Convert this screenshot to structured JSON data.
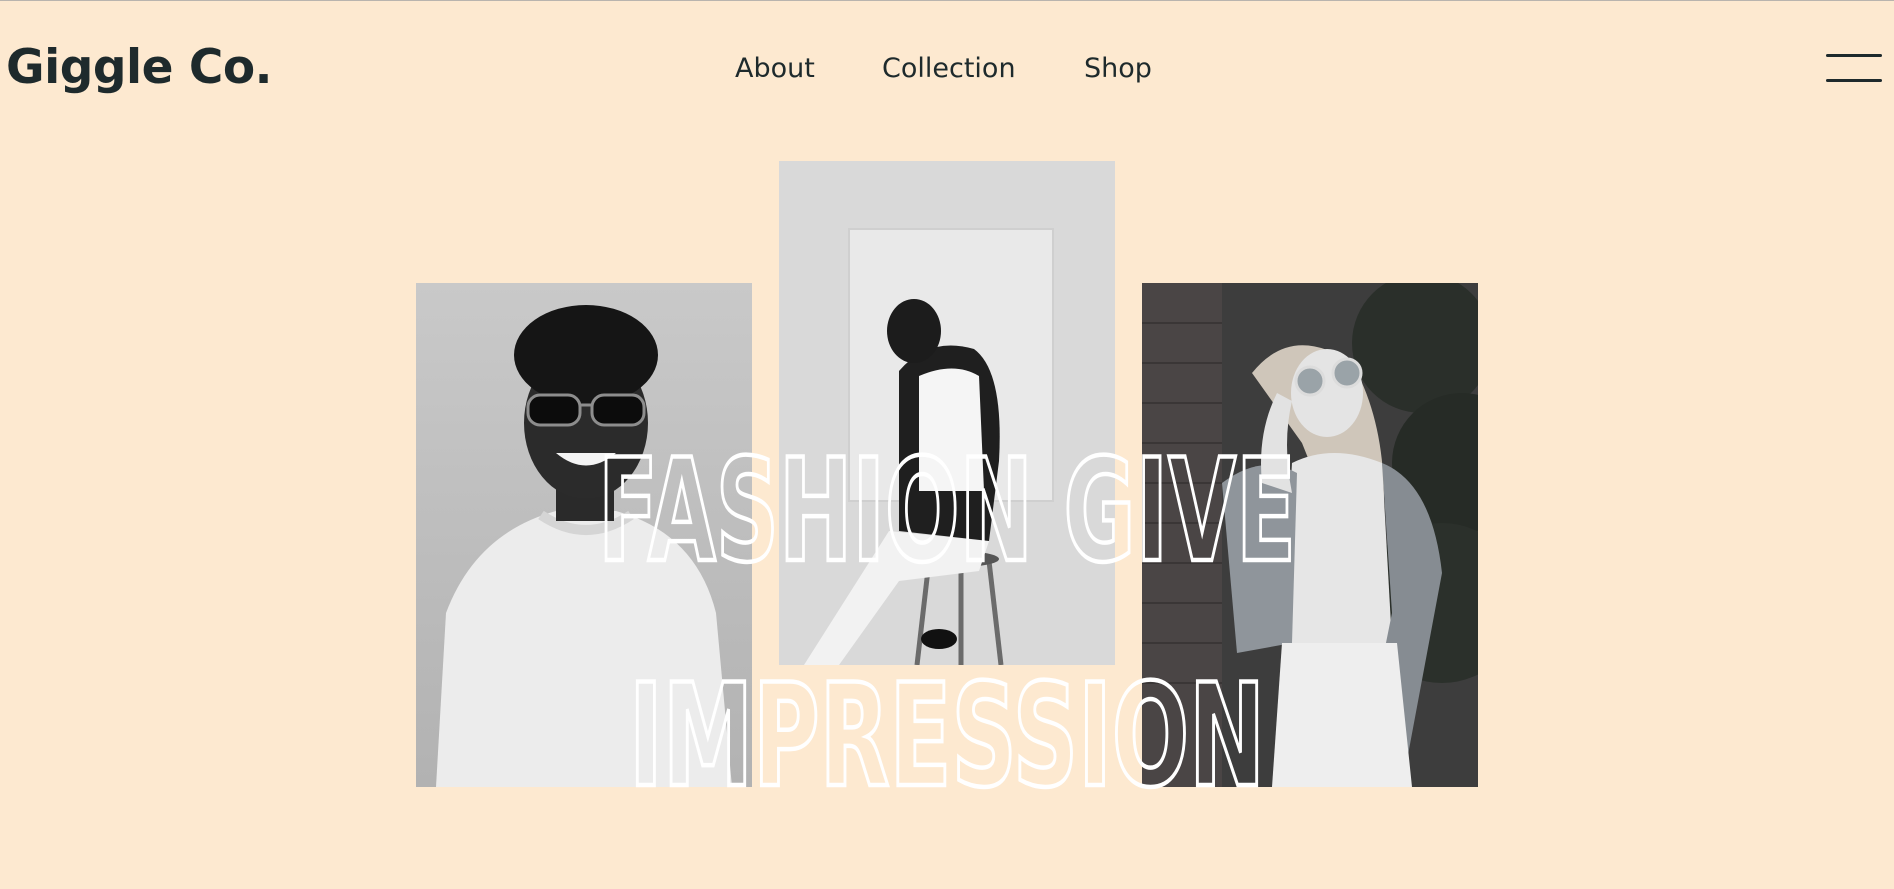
{
  "brand": {
    "name": "Giggle Co."
  },
  "nav": {
    "items": [
      {
        "label": "About"
      },
      {
        "label": "Collection"
      },
      {
        "label": "Shop"
      }
    ],
    "menu_icon": "hamburger-menu-icon"
  },
  "hero": {
    "headline_line_1": "FASHION GIVE",
    "headline_line_2": "IMPRESSION",
    "photos": [
      {
        "subject": "man-in-sunglasses-white-sweater"
      },
      {
        "subject": "man-sitting-on-stool"
      },
      {
        "subject": "woman-in-sunglasses-denim-jacket"
      }
    ]
  },
  "colors": {
    "background": "#fde9d0",
    "text": "#1e2a2c",
    "headline_outline": "#ffffff"
  }
}
